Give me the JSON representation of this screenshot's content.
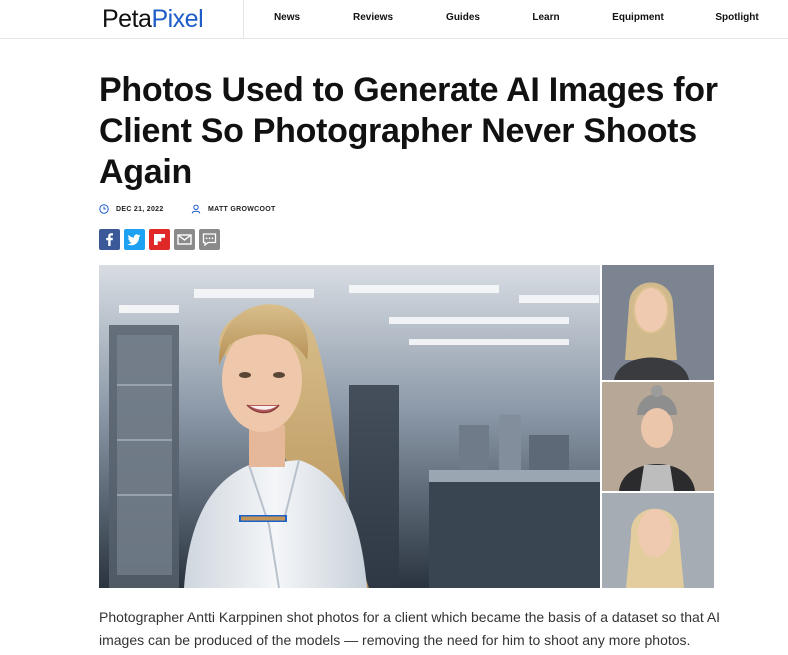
{
  "header": {
    "logo_part1": "Peta",
    "logo_part2": "Pixel",
    "nav": [
      "News",
      "Reviews",
      "Guides",
      "Learn",
      "Equipment",
      "Spotlight"
    ]
  },
  "article": {
    "title": "Photos Used to Generate AI Images for Client So Photographer Never Shoots Again",
    "date": "DEC 21, 2022",
    "author": "MATT GROWCOOT",
    "intro": "Photographer Antti Karppinen shot photos for a client which became the basis of a dataset so that AI images can be produced of the models — removing the need for him to shoot any more photos."
  },
  "share": {
    "icons": [
      "facebook-icon",
      "twitter-icon",
      "flipboard-icon",
      "email-icon",
      "comment-icon"
    ],
    "colors": {
      "facebook": "#3b5998",
      "twitter": "#1da1f2",
      "flipboard": "#e12828",
      "email": "#8a8a8a",
      "comment": "#8a8a8a"
    }
  },
  "colors": {
    "brand_blue": "#1e5cc8",
    "text": "#111111"
  }
}
